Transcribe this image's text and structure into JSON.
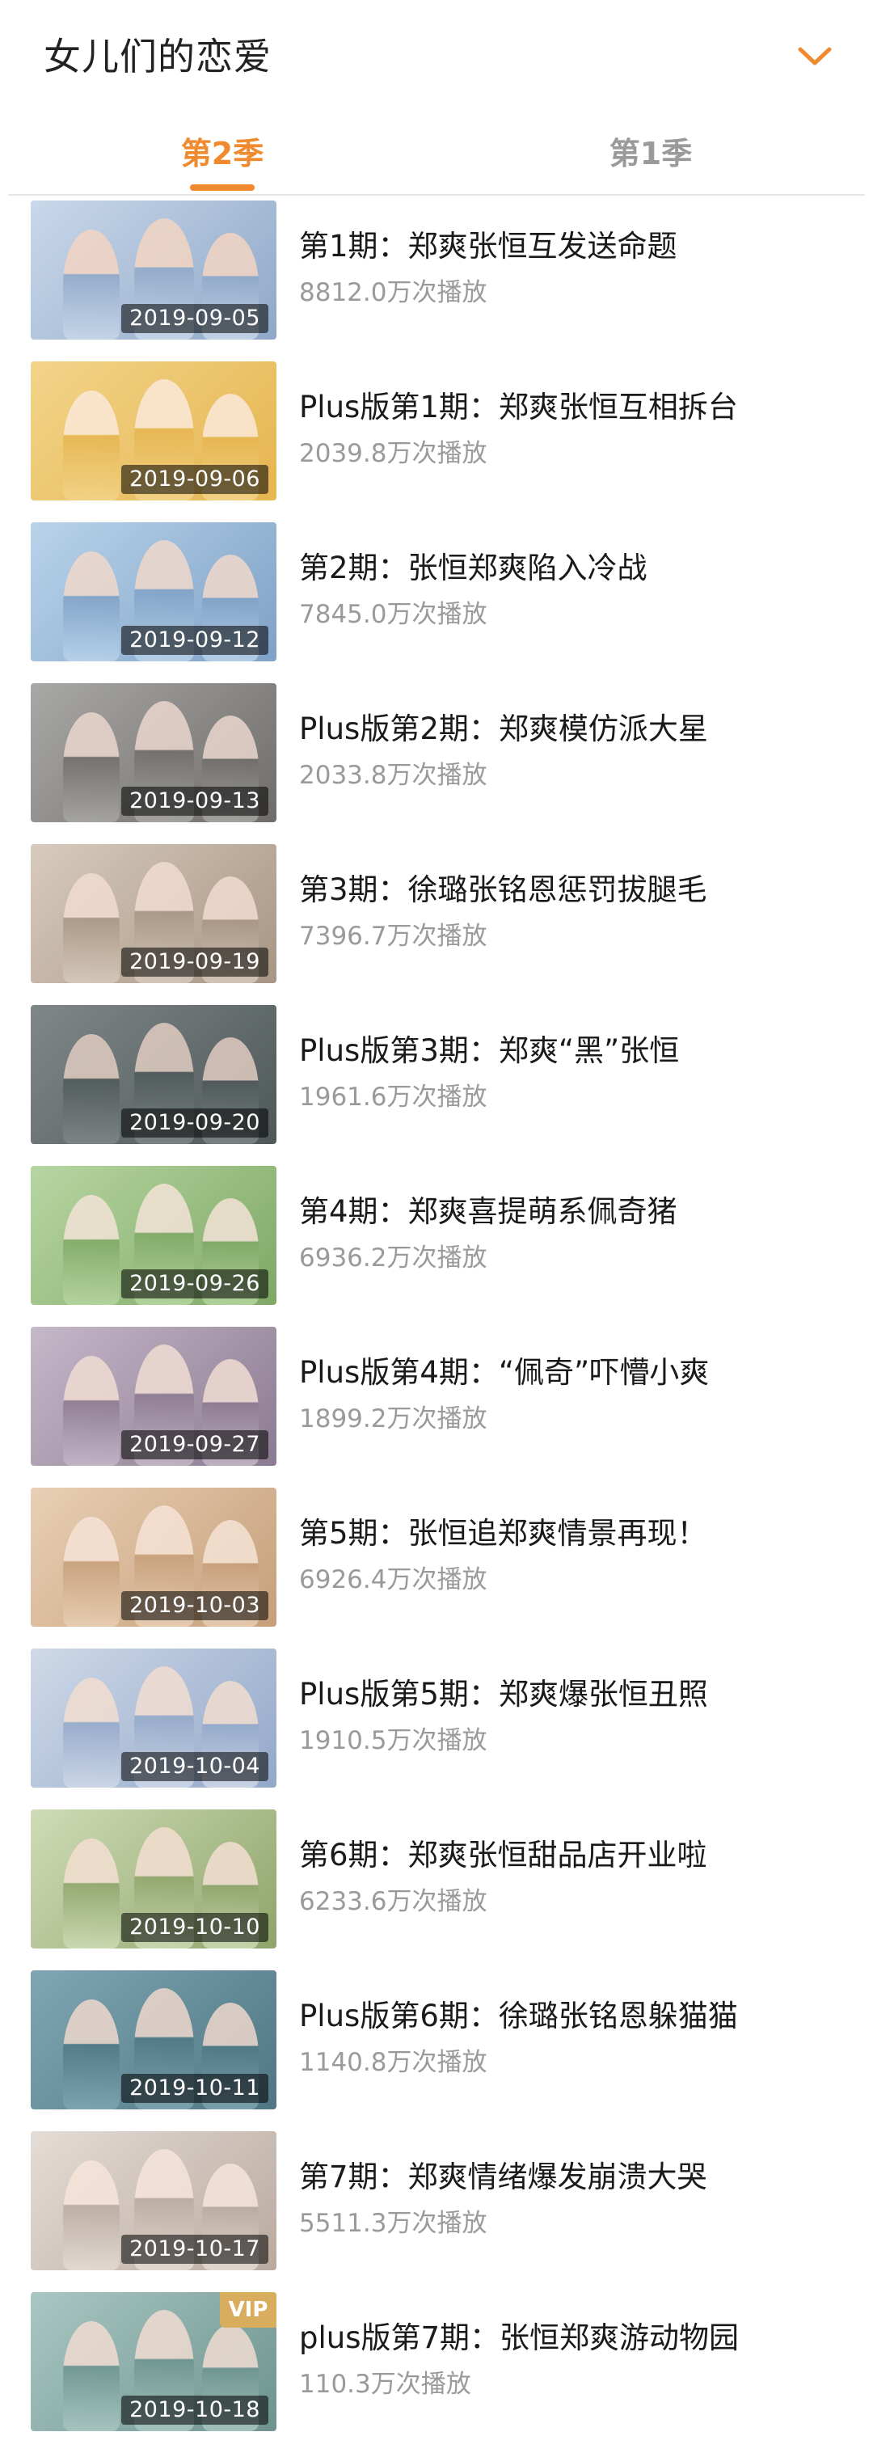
{
  "header": {
    "title": "女儿们的恋爱",
    "collapse_icon": "chevron-down-icon",
    "accent_color": "#f08a2f"
  },
  "tabs": [
    {
      "label": "第2季",
      "active": true
    },
    {
      "label": "第1季",
      "active": false
    }
  ],
  "episodes": [
    {
      "title": "第1期：郑爽张恒互发送命题",
      "plays": "8812.0万次播放",
      "date": "2019-09-05",
      "vip": false
    },
    {
      "title": "Plus版第1期：郑爽张恒互相拆台",
      "plays": "2039.8万次播放",
      "date": "2019-09-06",
      "vip": false
    },
    {
      "title": "第2期：张恒郑爽陷入冷战",
      "plays": "7845.0万次播放",
      "date": "2019-09-12",
      "vip": false
    },
    {
      "title": "Plus版第2期：郑爽模仿派大星",
      "plays": "2033.8万次播放",
      "date": "2019-09-13",
      "vip": false
    },
    {
      "title": "第3期：徐璐张铭恩惩罚拔腿毛",
      "plays": "7396.7万次播放",
      "date": "2019-09-19",
      "vip": false
    },
    {
      "title": "Plus版第3期：郑爽“黑”张恒",
      "plays": "1961.6万次播放",
      "date": "2019-09-20",
      "vip": false
    },
    {
      "title": "第4期：郑爽喜提萌系佩奇猪",
      "plays": "6936.2万次播放",
      "date": "2019-09-26",
      "vip": false
    },
    {
      "title": "Plus版第4期：“佩奇”吓懵小爽",
      "plays": "1899.2万次播放",
      "date": "2019-09-27",
      "vip": false
    },
    {
      "title": "第5期：张恒追郑爽情景再现！",
      "plays": "6926.4万次播放",
      "date": "2019-10-03",
      "vip": false
    },
    {
      "title": "Plus版第5期：郑爽爆张恒丑照",
      "plays": "1910.5万次播放",
      "date": "2019-10-04",
      "vip": false
    },
    {
      "title": "第6期：郑爽张恒甜品店开业啦",
      "plays": "6233.6万次播放",
      "date": "2019-10-10",
      "vip": false
    },
    {
      "title": "Plus版第6期：徐璐张铭恩躲猫猫",
      "plays": "1140.8万次播放",
      "date": "2019-10-11",
      "vip": false
    },
    {
      "title": "第7期：郑爽情绪爆发崩溃大哭",
      "plays": "5511.3万次播放",
      "date": "2019-10-17",
      "vip": false
    },
    {
      "title": "plus版第7期：张恒郑爽游动物园",
      "plays": "110.3万次播放",
      "date": "2019-10-18",
      "vip": true,
      "vip_label": "VIP"
    }
  ]
}
